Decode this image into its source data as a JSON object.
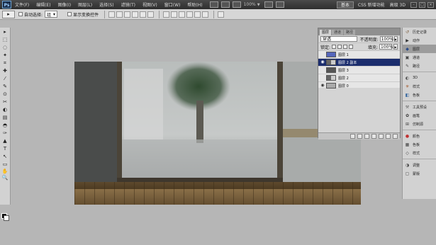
{
  "app": {
    "logo": "Ps"
  },
  "menubar": {
    "items": [
      "文件(F)",
      "编辑(E)",
      "图像(I)",
      "图层(L)",
      "选择(S)",
      "滤镜(T)",
      "视图(V)",
      "窗口(W)",
      "帮助(H)"
    ],
    "zoom": "100%",
    "workspace": "基本",
    "links": [
      "CSS 新增功能",
      "高级 3D"
    ]
  },
  "options": {
    "auto_select_label": "自动选择:",
    "auto_select_value": "组",
    "show_transform_label": "显示变换控件"
  },
  "layers_panel": {
    "tabs": [
      "图层",
      "通道",
      "路径"
    ],
    "blend_mode": "穿透",
    "opacity_label": "不透明度:",
    "opacity": "100%",
    "lock_label": "锁定:",
    "fill_label": "填充:",
    "fill": "100%",
    "layers": [
      {
        "name": "图层 1",
        "thumb": "blue",
        "visible": false,
        "selected": false
      },
      {
        "name": "图层 2 副本",
        "thumb": "mixed",
        "visible": true,
        "selected": true
      },
      {
        "name": "图层 3",
        "thumb": "dark",
        "visible": false,
        "selected": false
      },
      {
        "name": "图层 2",
        "thumb": "mixed",
        "visible": false,
        "selected": false
      },
      {
        "name": "图层 0",
        "thumb": "light",
        "visible": true,
        "selected": false
      }
    ]
  },
  "dock": {
    "items": [
      {
        "icon": "↺",
        "label": "历史记录",
        "color": "#7a5a3a"
      },
      {
        "icon": "▶",
        "label": "动作",
        "color": "#333"
      },
      {
        "icon": "◆",
        "label": "图层",
        "color": "#2a4a8a",
        "active": true
      },
      {
        "icon": "▣",
        "label": "通道",
        "color": "#444"
      },
      {
        "icon": "✎",
        "label": "路径",
        "color": "#444"
      },
      {
        "icon": "◐",
        "label": "3D",
        "color": "#555"
      },
      {
        "icon": "✳",
        "label": "样式",
        "color": "#a05020"
      },
      {
        "icon": "◧",
        "label": "色板",
        "color": "#3a6aa0"
      },
      {
        "icon": "⚒",
        "label": "工具预设",
        "color": "#666"
      },
      {
        "icon": "✿",
        "label": "画笔",
        "color": "#333"
      },
      {
        "icon": "⊞",
        "label": "仿制源",
        "color": "#444"
      },
      {
        "icon": "●",
        "label": "颜色",
        "color": "#c03030"
      },
      {
        "icon": "▦",
        "label": "色板",
        "color": "#444"
      },
      {
        "icon": "◇",
        "label": "样式",
        "color": "#444"
      },
      {
        "icon": "◑",
        "label": "调整",
        "color": "#444"
      },
      {
        "icon": "▢",
        "label": "蒙版",
        "color": "#444"
      }
    ]
  },
  "tools": [
    "▸",
    "⬚",
    "◌",
    "✦",
    "⌗",
    "✚",
    "⁄",
    "✎",
    "⊙",
    "✂",
    "◐",
    "▤",
    "◓",
    "✑",
    "▲",
    "T",
    "↖",
    "▭",
    "✋",
    "🔍"
  ]
}
